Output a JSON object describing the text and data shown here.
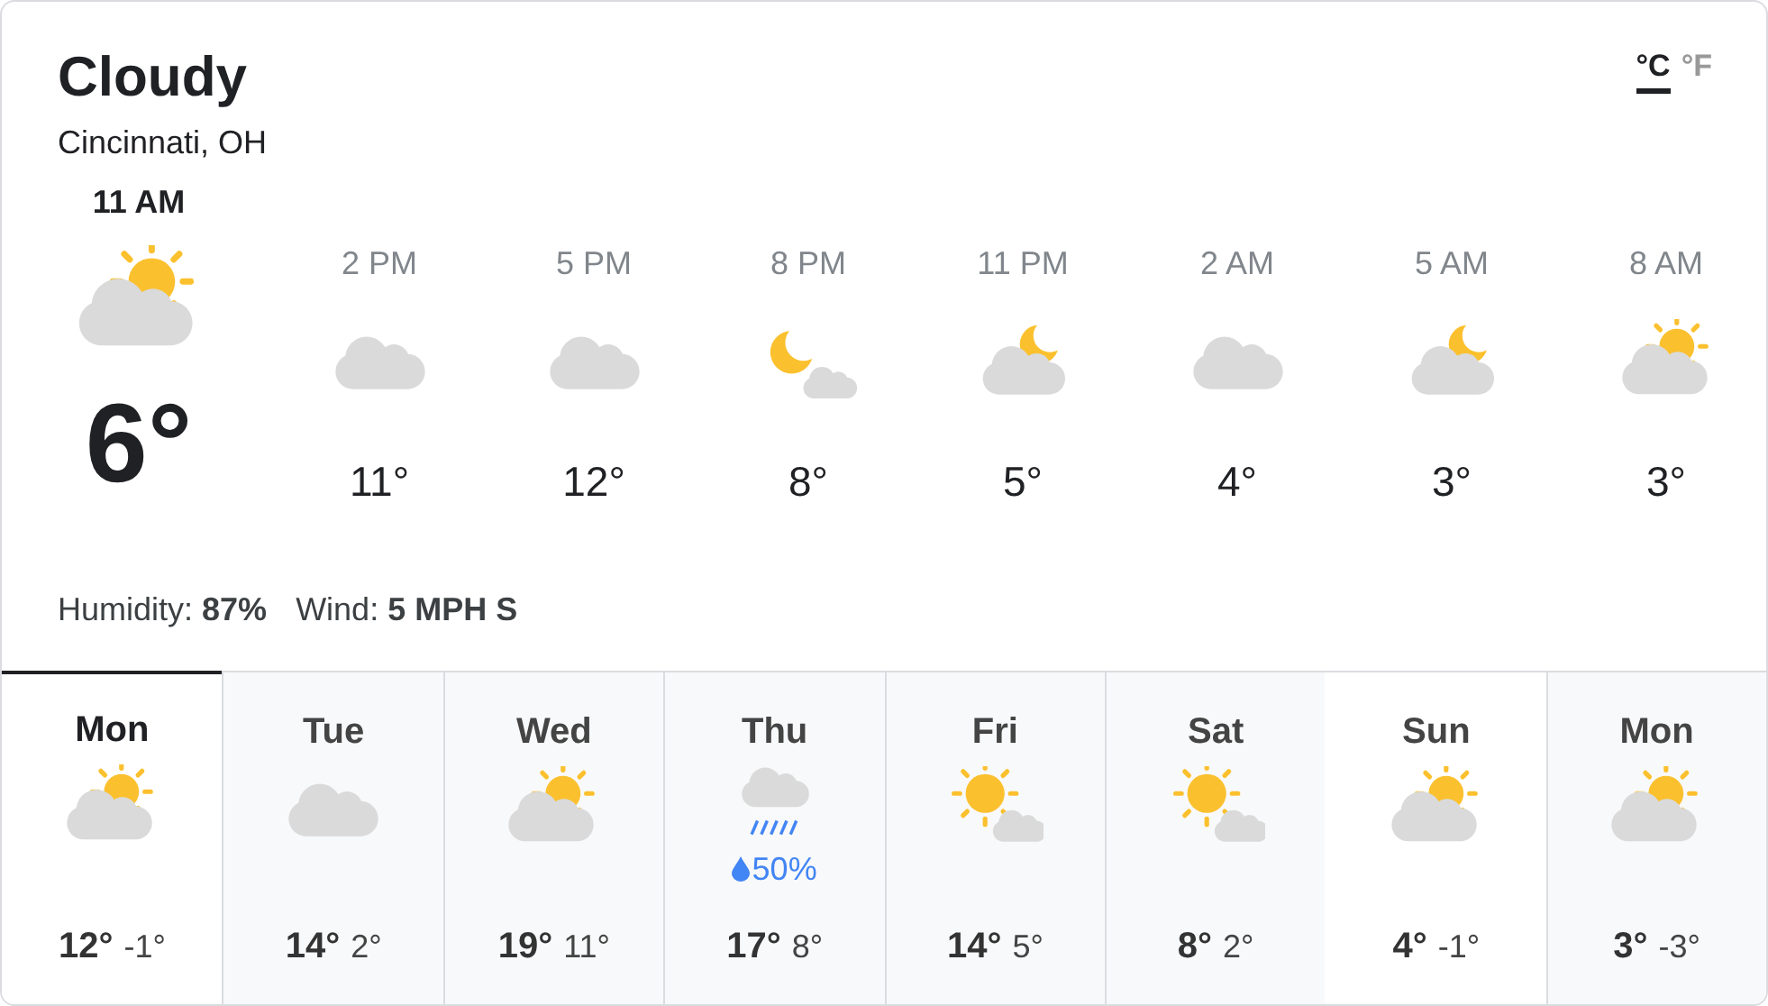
{
  "condition": "Cloudy",
  "location": "Cincinnati, OH",
  "units": [
    {
      "label": "°C",
      "selected": true
    },
    {
      "label": "°F",
      "selected": false
    }
  ],
  "current": {
    "time": "11 AM",
    "kind": "partly",
    "temp": "6°"
  },
  "hourly": [
    {
      "time": "2 PM",
      "kind": "cloudy",
      "temp": "11°"
    },
    {
      "time": "5 PM",
      "kind": "cloudy",
      "temp": "12°"
    },
    {
      "time": "8 PM",
      "kind": "moon",
      "temp": "8°"
    },
    {
      "time": "11 PM",
      "kind": "night",
      "temp": "5°"
    },
    {
      "time": "2 AM",
      "kind": "cloudy",
      "temp": "4°"
    },
    {
      "time": "5 AM",
      "kind": "night",
      "temp": "3°"
    },
    {
      "time": "8 AM",
      "kind": "partly",
      "temp": "3°"
    }
  ],
  "details": [
    {
      "label": "Humidity:",
      "value": "87%"
    },
    {
      "label": "Wind:",
      "value": "5 MPH S"
    }
  ],
  "daily": [
    {
      "day": "Mon",
      "kind": "partly",
      "high": "12°",
      "low": "-1°",
      "selected": true,
      "hovered": false
    },
    {
      "day": "Tue",
      "kind": "cloudy",
      "high": "14°",
      "low": "2°",
      "selected": false,
      "hovered": false
    },
    {
      "day": "Wed",
      "kind": "partly",
      "high": "19°",
      "low": "11°",
      "selected": false,
      "hovered": false
    },
    {
      "day": "Thu",
      "kind": "rain",
      "precip": "50%",
      "high": "17°",
      "low": "8°",
      "selected": false,
      "hovered": false
    },
    {
      "day": "Fri",
      "kind": "sunny",
      "high": "14°",
      "low": "5°",
      "selected": false,
      "hovered": false
    },
    {
      "day": "Sat",
      "kind": "sunny",
      "high": "8°",
      "low": "2°",
      "selected": false,
      "hovered": false
    },
    {
      "day": "Sun",
      "kind": "partly",
      "high": "4°",
      "low": "-1°",
      "selected": false,
      "hovered": true
    },
    {
      "day": "Mon",
      "kind": "partly",
      "high": "3°",
      "low": "-3°",
      "selected": false,
      "hovered": false
    }
  ]
}
